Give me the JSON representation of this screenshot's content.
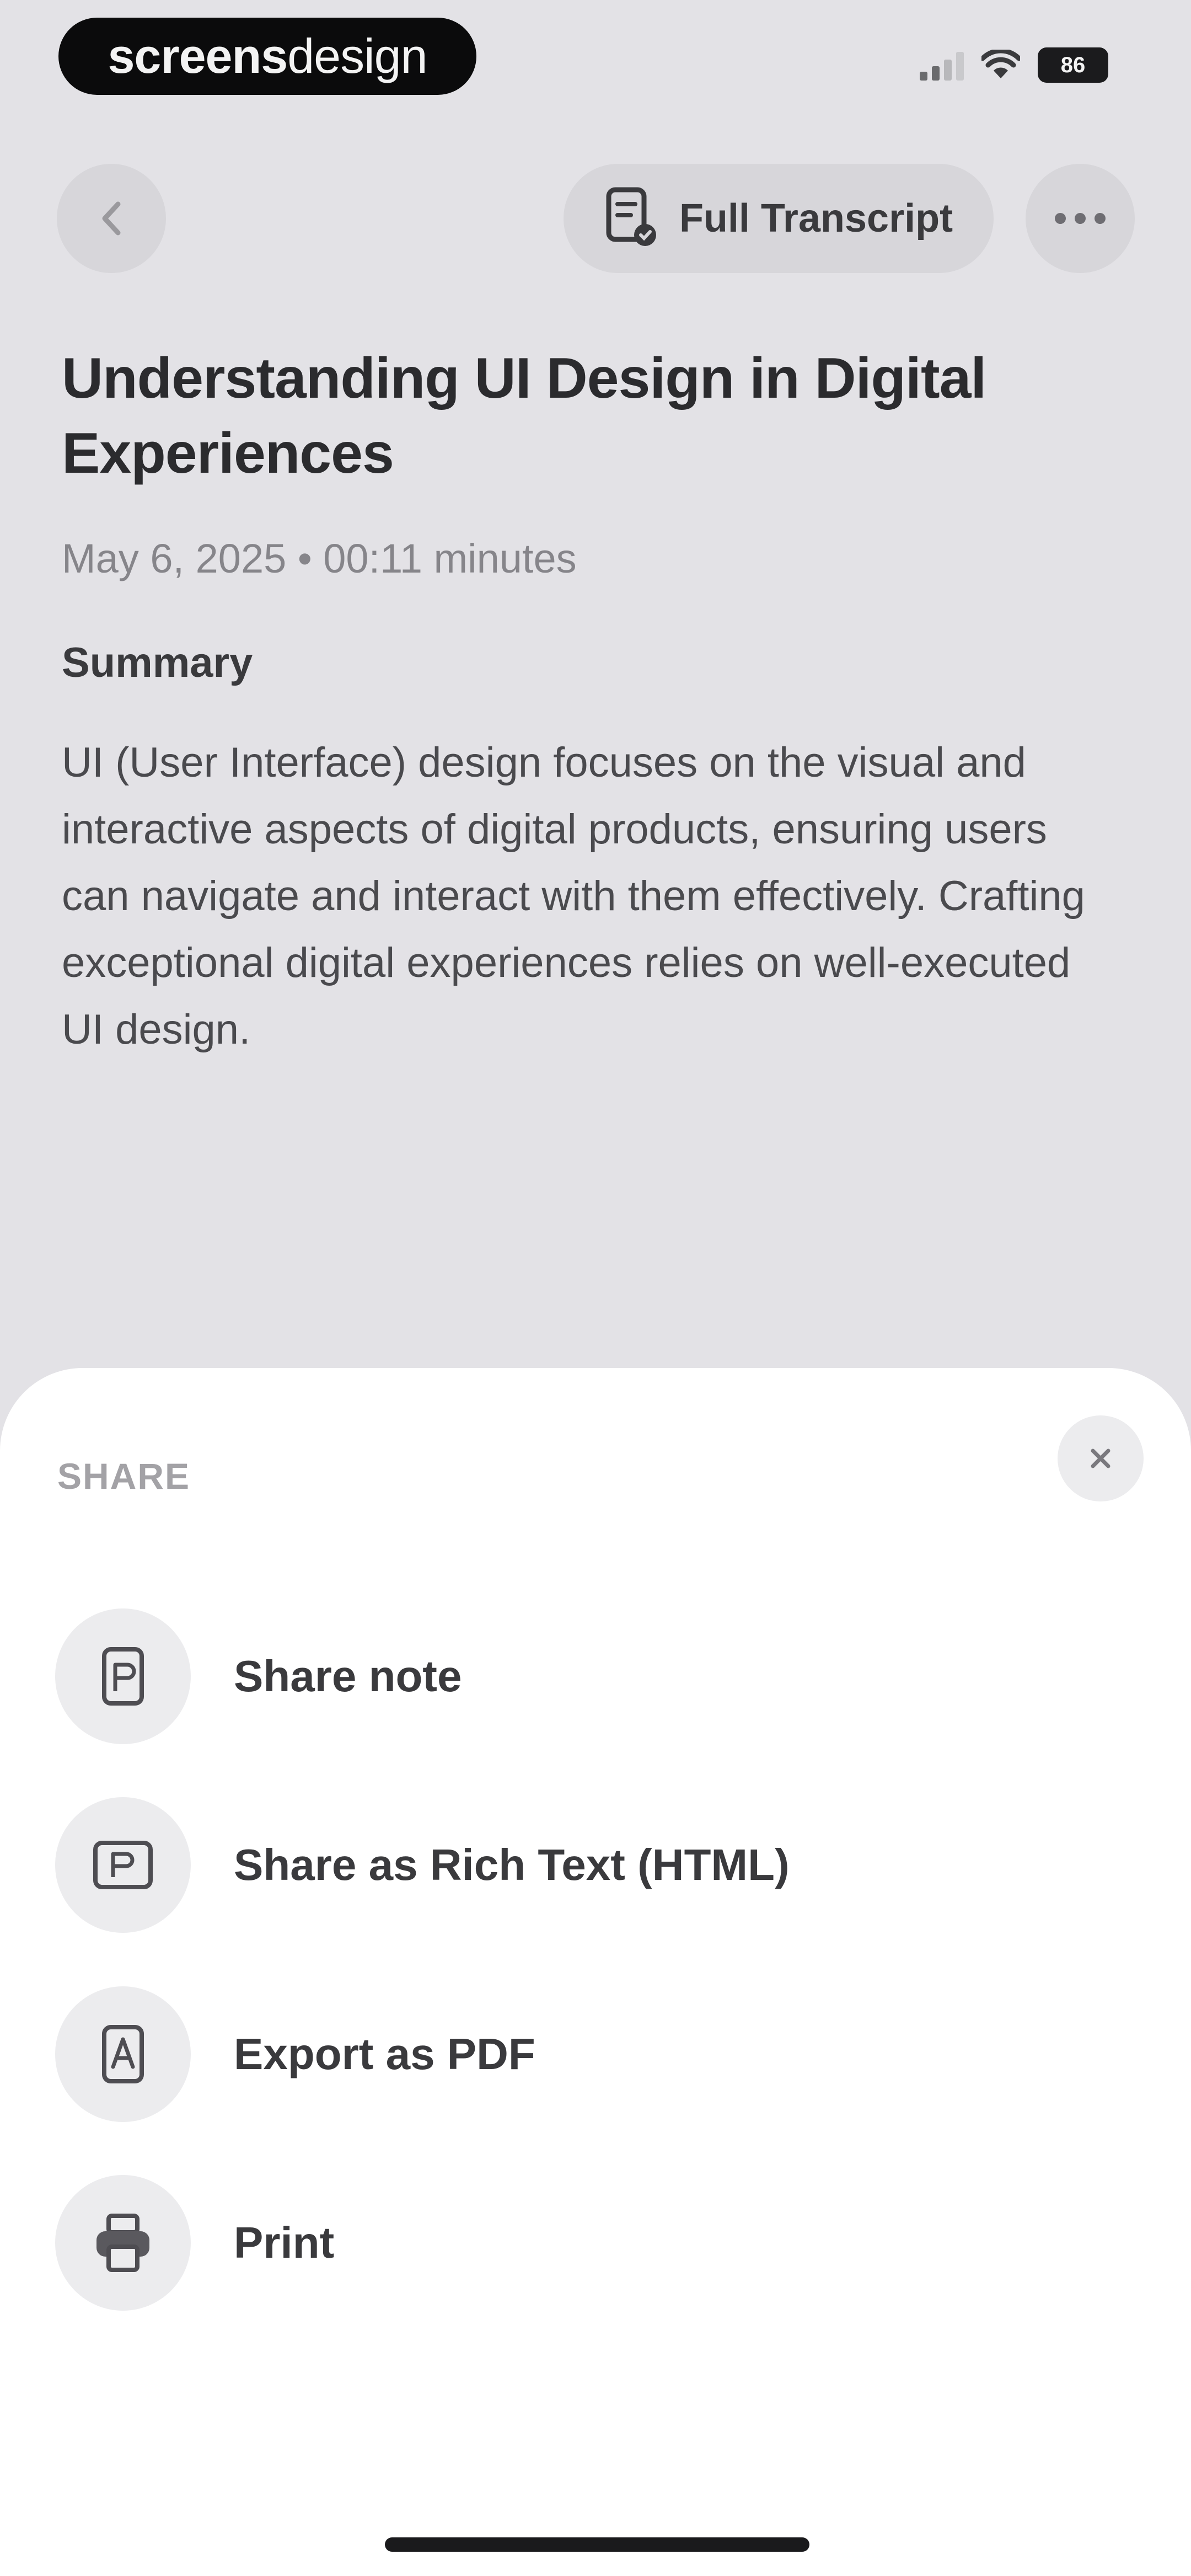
{
  "status_bar": {
    "brand_bold": "screens",
    "brand_light": "design",
    "battery": "86"
  },
  "nav": {
    "full_transcript_label": "Full Transcript"
  },
  "note": {
    "title": "Understanding UI Design in Digital Experiences",
    "meta": "May 6, 2025 • 00:11 minutes",
    "summary_heading": "Summary",
    "summary_text": "UI (User Interface) design focuses on the visual and interactive aspects of digital products, ensuring users can navigate and interact with them effectively. Crafting exceptional digital experiences relies on well-executed UI design."
  },
  "share_sheet": {
    "heading": "SHARE",
    "options": [
      {
        "label": "Share note",
        "icon": "note-icon"
      },
      {
        "label": "Share as Rich Text (HTML)",
        "icon": "rich-text-icon"
      },
      {
        "label": "Export as PDF",
        "icon": "pdf-icon"
      },
      {
        "label": "Print",
        "icon": "printer-icon"
      }
    ]
  },
  "colors": {
    "background": "#e3e2e6",
    "sheet": "#ffffff",
    "button_fill": "#d7d6da",
    "text_primary": "#2b2b2e",
    "text_secondary": "#86858a"
  }
}
